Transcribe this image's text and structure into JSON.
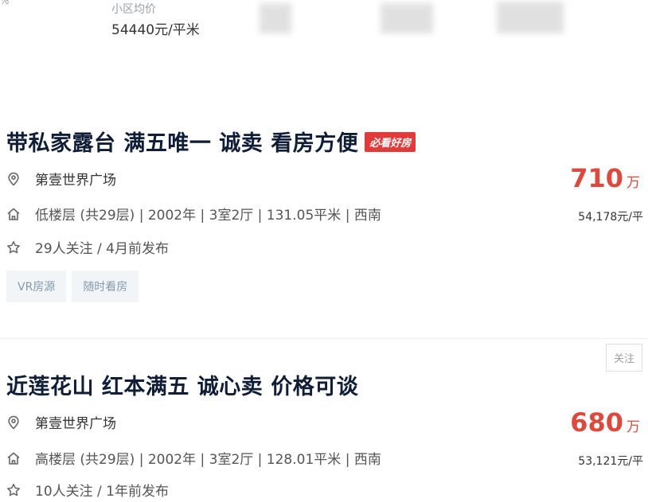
{
  "top": {
    "corner_fragment": "%",
    "avg_price_label": "小区均价",
    "avg_price_value": "54440元/平米"
  },
  "listings": [
    {
      "title": "带私家露台 满五唯一 诚卖 看房方便",
      "badge": "必看好房",
      "community": "第壹世界广场",
      "house_info": "低楼层 (共29层) | 2002年 | 3室2厅 | 131.05平米 | 西南",
      "follow_info": "29人关注 / 4月前发布",
      "total_price": "710",
      "price_unit": "万",
      "unit_price": "54,178元/平",
      "tags": [
        "VR房源",
        "随时看房"
      ]
    },
    {
      "follow_button": "关注",
      "title": "近莲花山 红本满五 诚心卖 价格可谈",
      "community": "第壹世界广场",
      "house_info": "高楼层 (共29层) | 2002年 | 3室2厅 | 128.01平米 | 西南",
      "follow_info": "10人关注 / 1年前发布",
      "total_price": "680",
      "price_unit": "万",
      "unit_price": "53,121元/平"
    }
  ],
  "colors": {
    "title": "#101d37",
    "price": "#db4a3f",
    "badge": "#e03b3b",
    "tag_bg": "#f2f5f7",
    "tag_text": "#849aae"
  },
  "icons": [
    "location-pin-icon",
    "house-icon",
    "star-icon"
  ]
}
